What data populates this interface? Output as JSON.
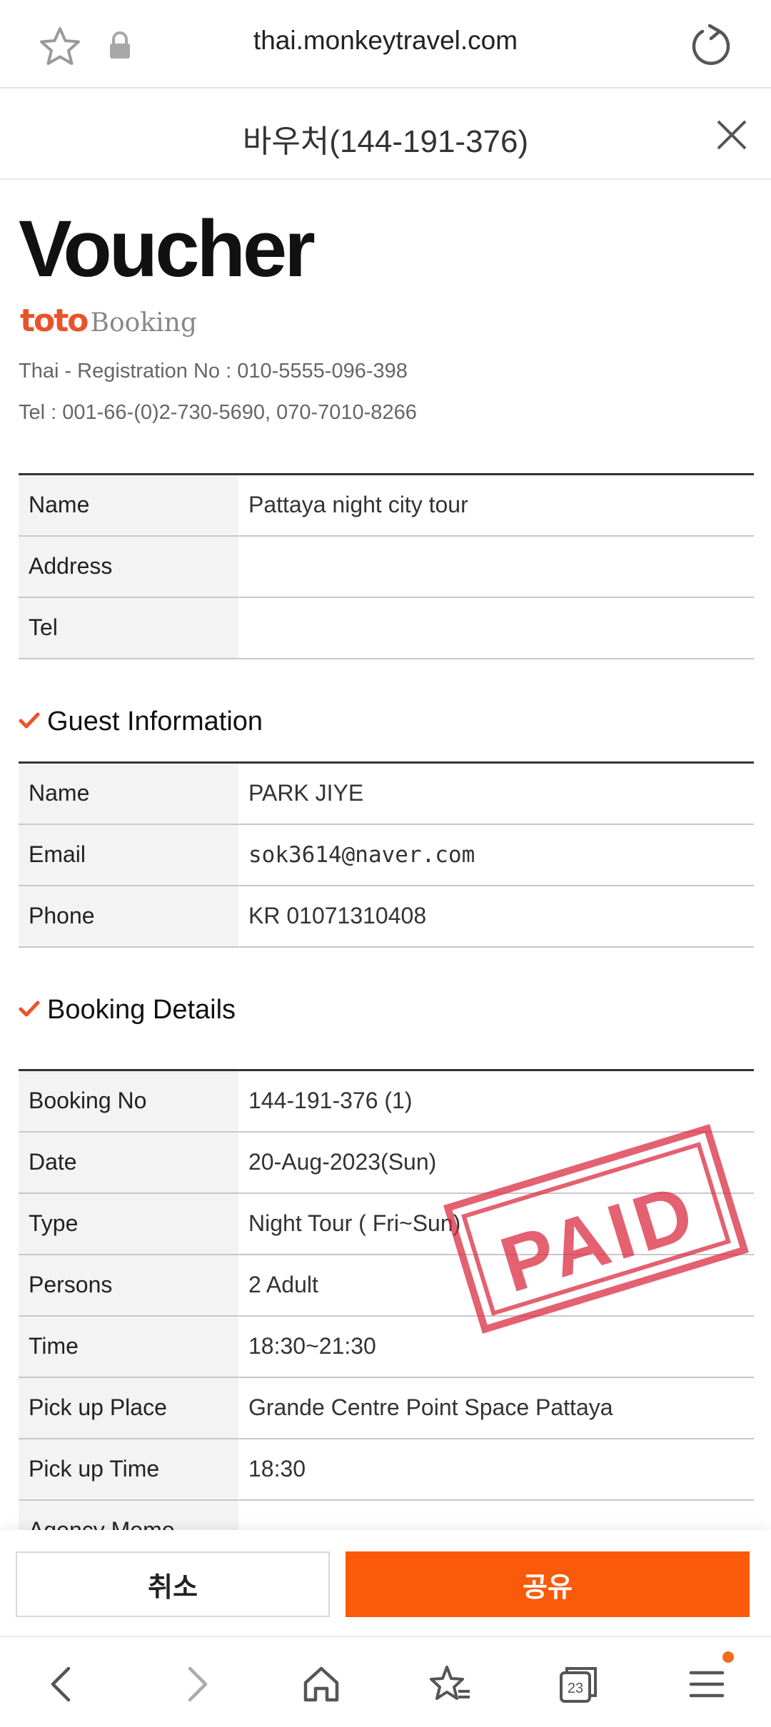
{
  "browser": {
    "url": "thai.monkeytravel.com",
    "tab_count": "23",
    "icons": [
      "star-icon",
      "lock-icon",
      "reload-icon",
      "back-icon",
      "forward-icon",
      "home-icon",
      "bookmarks-icon",
      "tabs-icon",
      "menu-icon"
    ]
  },
  "modal": {
    "title": "바우처(144-191-376)"
  },
  "voucher": {
    "heading": "Voucher",
    "logo": {
      "brand": "toto",
      "suffix": "Booking"
    },
    "registration": "Thai - Registration No : 010-5555-096-398",
    "tel": "Tel : 001-66-(0)2-730-5690, 070-7010-8266",
    "product_rows": [
      {
        "label": "Name",
        "value": "Pattaya night city tour"
      },
      {
        "label": "Address",
        "value": ""
      },
      {
        "label": "Tel",
        "value": ""
      }
    ],
    "guest_section_title": "Guest Information",
    "guest_rows": [
      {
        "label": "Name",
        "value": "PARK JIYE"
      },
      {
        "label": "Email",
        "value": "sok3614@naver.com"
      },
      {
        "label": "Phone",
        "value": "KR 01071310408"
      }
    ],
    "booking_section_title": "Booking Details",
    "booking_rows": [
      {
        "label": "Booking No",
        "value": "144-191-376 (1)"
      },
      {
        "label": "Date",
        "value": "20-Aug-2023(Sun)"
      },
      {
        "label": "Type",
        "value": "Night Tour ( Fri~Sun)"
      },
      {
        "label": "Persons",
        "value": "2 Adult"
      },
      {
        "label": "Time",
        "value": "18:30~21:30"
      },
      {
        "label": "Pick up Place",
        "value": "Grande Centre Point Space Pattaya"
      },
      {
        "label": "Pick up Time",
        "value": "18:30"
      },
      {
        "label": "Agency Memo",
        "value": ""
      }
    ],
    "stamp": "PAID"
  },
  "actions": {
    "cancel_label": "취소",
    "share_label": "공유"
  },
  "colors": {
    "accent": "#fa5a0a",
    "check": "#e8542a",
    "stamp": "#d8243a"
  }
}
